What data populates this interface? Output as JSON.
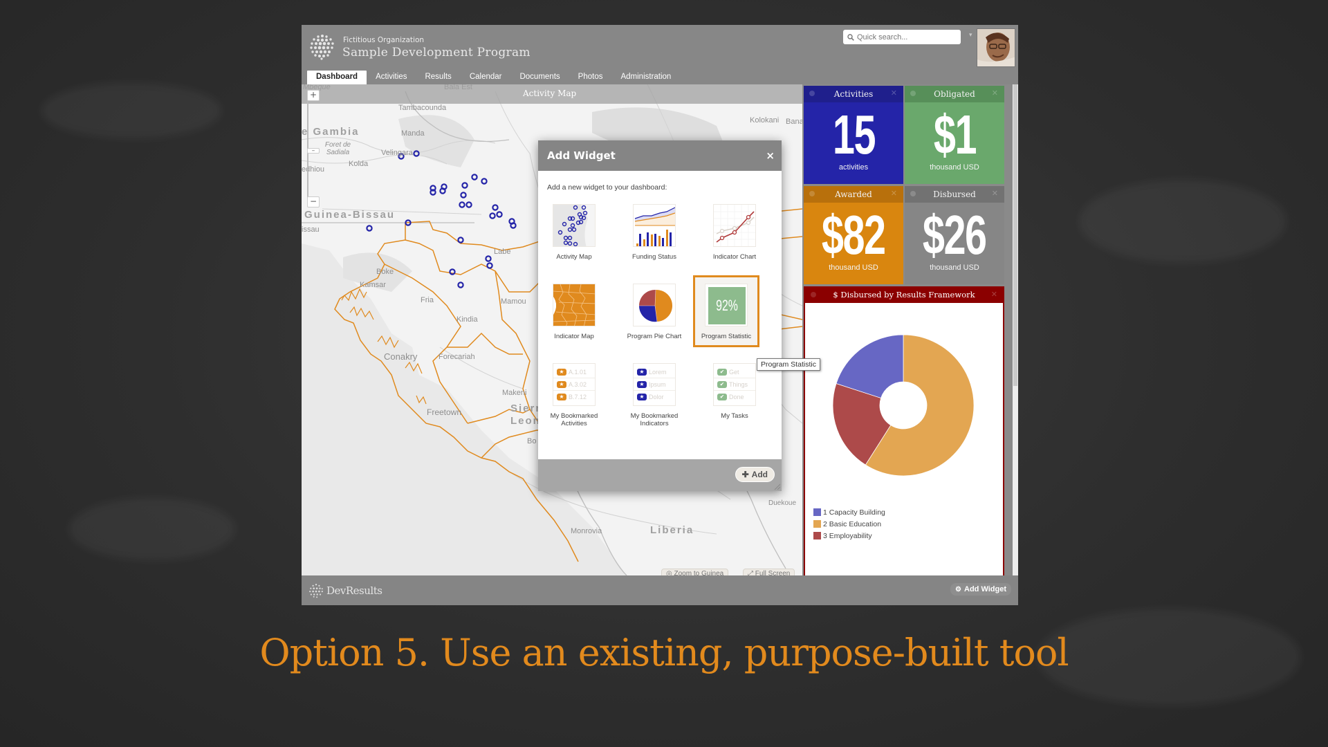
{
  "header": {
    "org_name": "Fictitious Organization",
    "program_name": "Sample Development Program",
    "search_placeholder": "Quick search...",
    "user_menu_caret": "▾"
  },
  "tabs": [
    {
      "label": "Dashboard",
      "active": true
    },
    {
      "label": "Activities"
    },
    {
      "label": "Results"
    },
    {
      "label": "Calendar"
    },
    {
      "label": "Documents"
    },
    {
      "label": "Photos"
    },
    {
      "label": "Administration"
    }
  ],
  "map": {
    "title": "Activity Map",
    "zoom_in": "+",
    "zoom_out": "−",
    "labels": {
      "gambia": "e Gambia",
      "guinea_bissau": "Guinea-Bissau",
      "bissau": "issau",
      "mbegue": "Mbegue",
      "bala_est": "Bala Est",
      "tambacounda": "Tambacounda",
      "manda": "Manda",
      "foret": "Foret de Sadiala",
      "velingara": "Velingara",
      "kolda": "Kolda",
      "sedhiou": "edhiou",
      "kolokani": "Kolokani",
      "banamba": "Banamba",
      "labe": "Labe",
      "boke": "Boke",
      "kamsar": "Kamsar",
      "fria": "Fria",
      "mamou": "Mamou",
      "kindia": "Kindia",
      "conakry": "Conakry",
      "forecariah": "Forecariah",
      "makeni": "Makeni",
      "sierra_leone": "Sierr Leon",
      "freetown": "Freetown",
      "bo": "Bo",
      "monrovia": "Monrovia",
      "liberia": "Liberia",
      "duekoue": "Duekoue"
    },
    "buttons": {
      "zoom_to": "Zoom to Guinea",
      "full_screen": "Full Screen"
    }
  },
  "tiles": [
    {
      "title": "Activities",
      "value": "15",
      "unit": "activities",
      "color": "#2424a8",
      "head_color": "#1f1f8c"
    },
    {
      "title": "Obligated",
      "value": "$1",
      "unit": "thousand USD",
      "color": "#6aa86c",
      "head_color": "#578f59"
    },
    {
      "title": "Awarded",
      "value": "$82",
      "unit": "thousand USD",
      "color": "#d9860f",
      "head_color": "#b8700c"
    },
    {
      "title": "Disbursed",
      "value": "$26",
      "unit": "thousand USD",
      "color": "#868686",
      "head_color": "#727272"
    }
  ],
  "donut": {
    "title": "$ Disbursed by Results Framework",
    "accent": "#8b0000"
  },
  "chart_data": {
    "type": "pie",
    "title": "$ Disbursed by Results Framework",
    "donut": true,
    "start_angle_deg": 0,
    "direction": "clockwise",
    "legend_position": "bottom-left",
    "slices": [
      {
        "label": "1 Capacity Building",
        "value": 20,
        "color": "#6767c4"
      },
      {
        "label": "2 Basic Education",
        "value": 59,
        "color": "#e3a652"
      },
      {
        "label": "3 Employability",
        "value": 21,
        "color": "#ad4a4a"
      }
    ],
    "draw_order": [
      "2 Basic Education",
      "3 Employability",
      "1 Capacity Building"
    ]
  },
  "modal": {
    "title": "Add Widget",
    "close": "×",
    "intro": "Add a new widget to your dashboard:",
    "options": [
      {
        "label": "Activity Map"
      },
      {
        "label": "Funding Status"
      },
      {
        "label": "Indicator Chart"
      },
      {
        "label": "Indicator Map"
      },
      {
        "label": "Program Pie Chart"
      },
      {
        "label": "Program Statistic",
        "selected": true,
        "thumb_value": "92%"
      },
      {
        "label": "My Bookmarked Activities",
        "rows": [
          "A.1.01",
          "A.3.02",
          "B.7.12"
        ]
      },
      {
        "label": "My Bookmarked Indicators",
        "rows": [
          "Lorem",
          "Ipsum",
          "Dolor"
        ]
      },
      {
        "label": "My Tasks",
        "rows": [
          "Get",
          "Things",
          "Done"
        ]
      }
    ],
    "add_button": "Add"
  },
  "tooltip": "Program Statistic",
  "footer": {
    "brand": "DevResults",
    "add_widget": "Add Widget"
  },
  "caption": "Option 5. Use an existing, purpose-built tool"
}
